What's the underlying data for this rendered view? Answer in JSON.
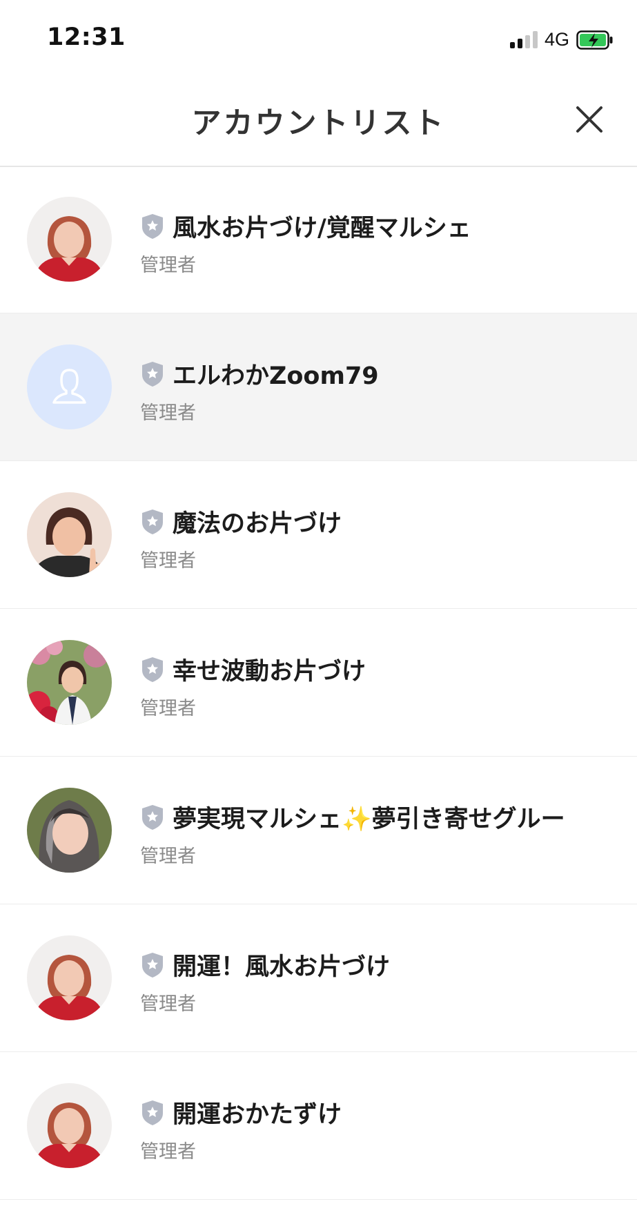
{
  "status_bar": {
    "time": "12:31",
    "network": "4G",
    "signal_icon": "cellular-signal-icon",
    "battery_icon": "battery-charging-icon",
    "battery_color": "#34c759"
  },
  "header": {
    "title": "アカウントリスト",
    "close_icon": "close-icon"
  },
  "colors": {
    "selected_row": "#f4f4f4",
    "shield": "#b3b8c4",
    "placeholder_avatar": "#dbe7fd",
    "role_text": "#8a8a8a"
  },
  "accounts": [
    {
      "name": "風水お片づけ/覚醒マルシェ",
      "role": "管理者",
      "badge_icon": "shield-star-icon",
      "avatar": "photo"
    },
    {
      "name": "エルわかZoom79",
      "role": "管理者",
      "badge_icon": "shield-star-icon",
      "avatar": "placeholder-person-icon",
      "selected": true
    },
    {
      "name": "魔法のお片づけ",
      "role": "管理者",
      "badge_icon": "shield-star-icon",
      "avatar": "photo"
    },
    {
      "name": "幸せ波動お片づけ",
      "role": "管理者",
      "badge_icon": "shield-star-icon",
      "avatar": "photo"
    },
    {
      "name": "夢実現マルシェ✨夢引き寄せグルー",
      "role": "管理者",
      "badge_icon": "shield-star-icon",
      "avatar": "photo"
    },
    {
      "name": "開運！風水お片づけ",
      "role": "管理者",
      "badge_icon": "shield-star-icon",
      "avatar": "photo"
    },
    {
      "name": "開運おかたずけ",
      "role": "管理者",
      "badge_icon": "shield-star-icon",
      "avatar": "photo"
    }
  ]
}
